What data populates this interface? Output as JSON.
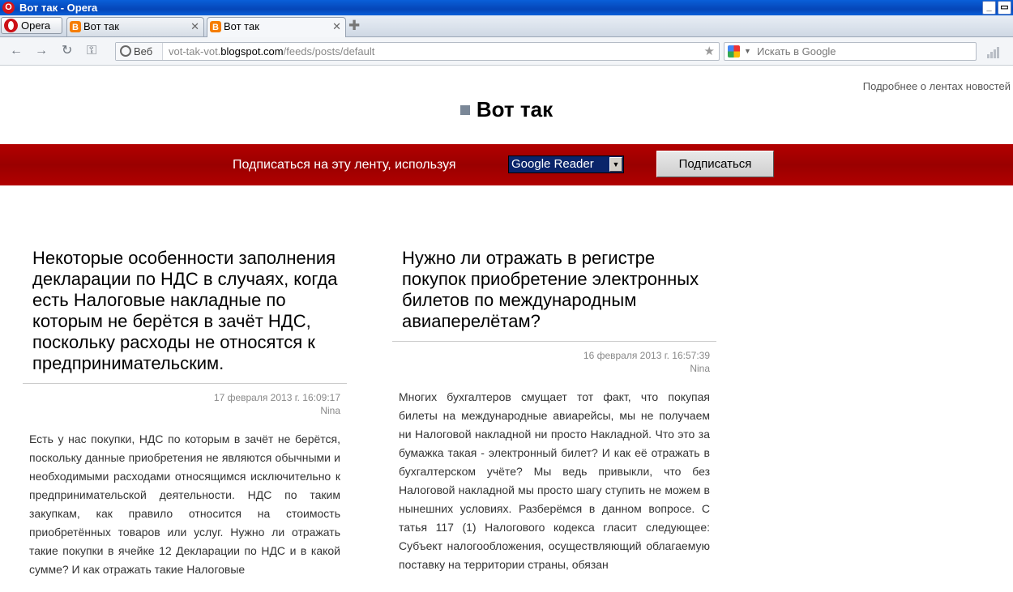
{
  "window": {
    "title": "Вот так - Opera"
  },
  "tabs": {
    "menu_label": "Opera",
    "items": [
      {
        "label": "Вот так"
      },
      {
        "label": "Вот так"
      }
    ]
  },
  "nav": {
    "badge": "Веб",
    "url_pre": "vot-tak-vot.",
    "url_host": "blogspot.com",
    "url_post": "/feeds/posts/default",
    "search_placeholder": "Искать в Google"
  },
  "page": {
    "about_link": "Подробнее о лентах новостей",
    "feed_title": "Вот так",
    "subscribe_label": "Подписаться на эту ленту, используя",
    "reader_select": "Google Reader",
    "subscribe_button": "Подписаться"
  },
  "posts": [
    {
      "title": "Некоторые особенности заполнения декларации по НДС в случаях, когда есть Налоговые накладные по которым не берётся в зачёт НДС, поскольку расходы не относятся к предпринимательским.",
      "date": "17 февраля 2013 г. 16:09:17",
      "author": "Nina",
      "body": "Есть у нас покупки, НДС по которым в зачёт не берётся, поскольку данные приобретения не являются обычными и необходимыми расходами относящимся исключительно к предпринимательской деятельности. НДС по таким закупкам, как правило относится на стоимость приобретённых товаров или услуг. Нужно ли отражать такие покупки в ячейке 12 Декларации по НДС и в какой сумме? И как отражать такие Налоговые"
    },
    {
      "title": "Нужно ли отражать в регистре покупок приобретение электронных билетов по международным авиаперелётам?",
      "date": "16 февраля 2013 г. 16:57:39",
      "author": "Nina",
      "body": "Многих бухгалтеров смущает тот факт, что покупая билеты на международные авиарейсы, мы не получаем ни Налоговой накладной ни просто Накладной. Что это за бумажка такая - электронный билет? И как её отражать в бухгалтерском учёте? Мы ведь привыкли, что без Налоговой накладной мы просто шагу ступить не можем в нынешних условиях. Разберёмся в данном вопросе. С татья 117 (1) Налогового кодекса гласит следующее: Субъект налогообложения, осуществляющий облагаемую поставку на территории страны, обязан"
    }
  ]
}
